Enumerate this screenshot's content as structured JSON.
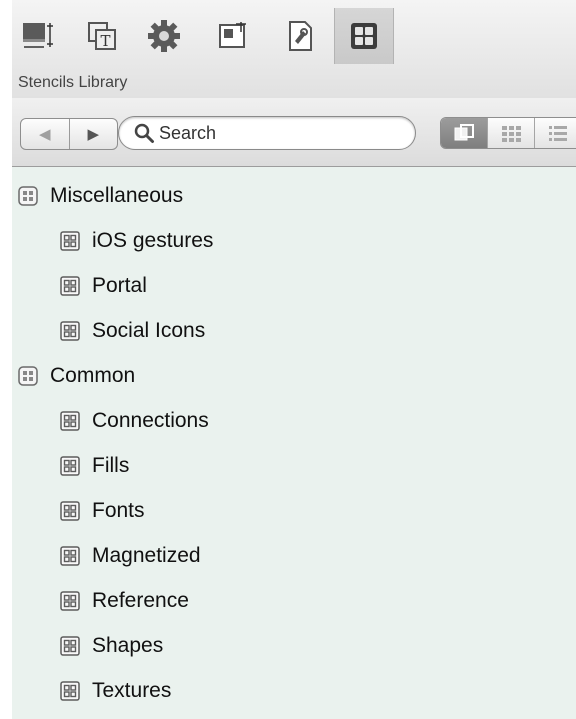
{
  "toolbar": {
    "title": "Stencils Library",
    "tools": [
      {
        "icon": "canvas-icon"
      },
      {
        "icon": "properties-icon"
      },
      {
        "icon": "gear-icon"
      },
      {
        "icon": "layout-icon"
      },
      {
        "icon": "document-icon"
      },
      {
        "icon": "stencils-icon",
        "selected": true
      }
    ]
  },
  "search": {
    "placeholder": "Search",
    "value": ""
  },
  "nav": {
    "back_icon": "◀",
    "forward_icon": "▶"
  },
  "colors": {
    "panel_bg": "#eaf2ee",
    "toolbar_bg": "#e6e6e6"
  },
  "library": {
    "groups": [
      {
        "label": "Miscellaneous",
        "items": [
          "iOS gestures",
          "Portal",
          "Social Icons"
        ]
      },
      {
        "label": "Common",
        "items": [
          "Connections",
          "Fills",
          "Fonts",
          "Magnetized",
          "Reference",
          "Shapes",
          "Textures"
        ]
      }
    ]
  }
}
